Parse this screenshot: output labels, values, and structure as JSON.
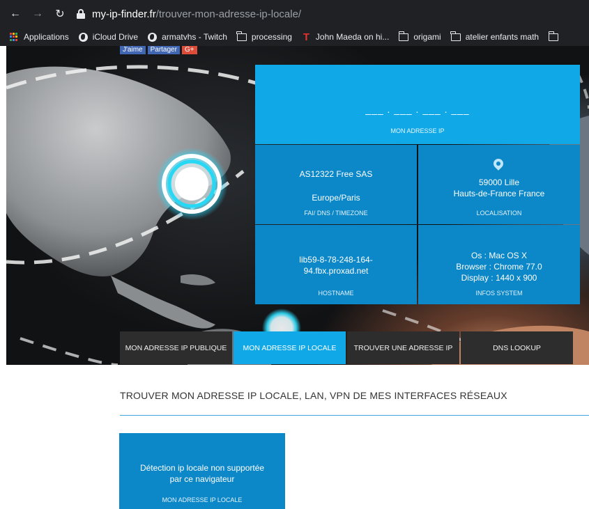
{
  "browser": {
    "url_host": "my-ip-finder.fr",
    "url_path": "/trouver-mon-adresse-ip-locale/",
    "bookmarks": [
      {
        "label": "Applications",
        "icon": "apps-grid-icon"
      },
      {
        "label": "iCloud Drive",
        "icon": "globe-icon"
      },
      {
        "label": "armatvhs - Twitch",
        "icon": "globe-icon"
      },
      {
        "label": "processing",
        "icon": "folder-icon"
      },
      {
        "label": "John Maeda on hi...",
        "icon": "t-logo-icon"
      },
      {
        "label": "origami",
        "icon": "folder-icon"
      },
      {
        "label": "atelier enfants math",
        "icon": "folder-icon"
      }
    ]
  },
  "social": {
    "like": "J'aime",
    "share": "Partager",
    "gplus": "G+"
  },
  "ip_panel": {
    "ip_value": "___ . ___ . ___ . ___",
    "ip_label": "MON ADRESSE IP",
    "isp": {
      "line1": "AS12322 Free SAS",
      "line2": "Europe/Paris",
      "caption": "FAI/ DNS / TIMEZONE"
    },
    "location": {
      "line1": "59000 Lille",
      "line2": "Hauts-de-France France",
      "caption": "LOCALISATION"
    },
    "hostname": {
      "line1": "lib59-8-78-248-164-",
      "line2": "94.fbx.proxad.net",
      "caption": "HOSTNAME"
    },
    "system": {
      "line1": "Os : Mac OS X",
      "line2": "Browser : Chrome 77.0",
      "line3": "Display : 1440 x 900",
      "caption": "INFOS SYSTEM"
    }
  },
  "tabs": [
    {
      "label": "MON ADRESSE IP PUBLIQUE",
      "active": false
    },
    {
      "label": "MON ADRESSE IP LOCALE",
      "active": true
    },
    {
      "label": "TROUVER UNE ADRESSE IP",
      "active": false
    },
    {
      "label": "DNS LOOKUP",
      "active": false
    }
  ],
  "content": {
    "title": "TROUVER MON ADRESSE IP LOCALE, LAN, VPN DE MES INTERFACES RÉSEAUX",
    "local_box": {
      "line1": "Détection ip locale non supportée",
      "line2": "par ce navigateur",
      "caption": "MON ADRESSE IP LOCALE"
    }
  },
  "colors": {
    "accent": "#11a8e8",
    "cell": "#0c87c7",
    "tab_bg": "#2e2d2d",
    "chrome_bg": "#202124"
  }
}
